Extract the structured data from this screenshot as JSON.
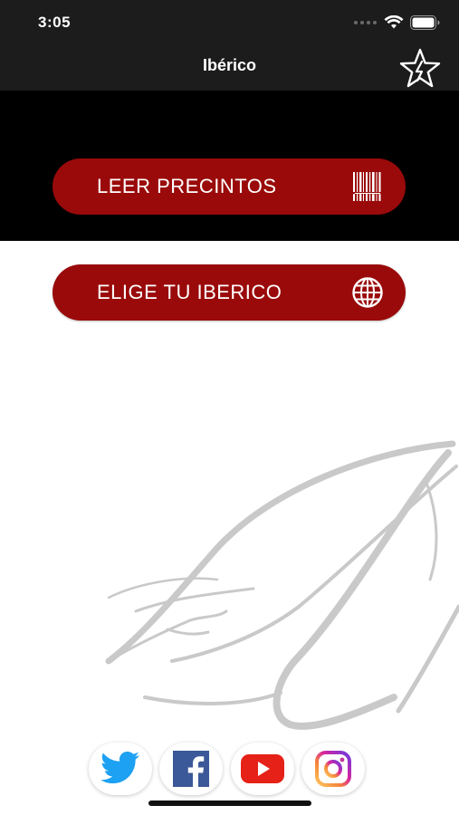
{
  "status_bar": {
    "time": "3:05"
  },
  "nav": {
    "title": "Ibérico",
    "favorite_icon": "star-icon"
  },
  "buttons": {
    "leer_precintos": {
      "label": "LEER PRECINTOS",
      "icon": "barcode-icon"
    },
    "elige_iberico": {
      "label": "ELIGE TU IBERICO",
      "icon": "globe-icon"
    }
  },
  "social": [
    {
      "name": "twitter",
      "icon": "twitter-icon",
      "color": "#1da1f2"
    },
    {
      "name": "facebook",
      "icon": "facebook-icon",
      "color": "#3b5998"
    },
    {
      "name": "youtube",
      "icon": "youtube-icon",
      "color": "#e62117"
    },
    {
      "name": "instagram",
      "icon": "instagram-icon",
      "color": "#d6249f"
    }
  ],
  "colors": {
    "bar_background": "#1c1c1c",
    "band_background": "#000000",
    "button_red": "#9a0a0a",
    "watermark_gray": "#c8c8c8"
  }
}
